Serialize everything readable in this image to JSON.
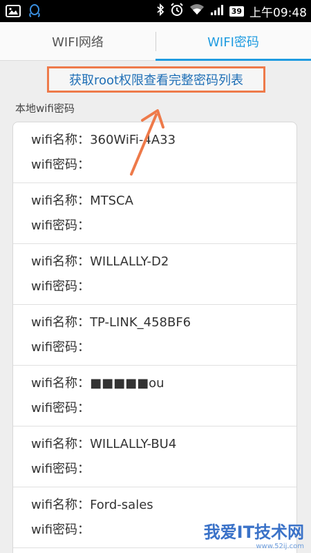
{
  "status_bar": {
    "battery": "39",
    "time": "上午09:48"
  },
  "tabs": [
    {
      "label": "WIFI网络",
      "active": false
    },
    {
      "label": "WIFI密码",
      "active": true
    }
  ],
  "root_button": "获取root权限查看完整密码列表",
  "section_title": "本地wifi密码",
  "labels": {
    "name": "wifi名称：",
    "password": "wifi密码："
  },
  "networks": [
    {
      "name": "360WiFi-4A33",
      "password": ""
    },
    {
      "name": "MTSCA",
      "password": ""
    },
    {
      "name": "WILLALLY-D2",
      "password": ""
    },
    {
      "name": "TP-LINK_458BF6",
      "password": ""
    },
    {
      "name": "■■■■■ou",
      "password": ""
    },
    {
      "name": "WILLALLY-BU4",
      "password": ""
    },
    {
      "name": "Ford-sales",
      "password": ""
    }
  ],
  "watermark": {
    "text": "我爱IT技术网",
    "url": "www.52ij.com"
  },
  "colors": {
    "accent": "#1e9be0",
    "highlight": "#ee7a4a",
    "link": "#1f6fb6"
  }
}
